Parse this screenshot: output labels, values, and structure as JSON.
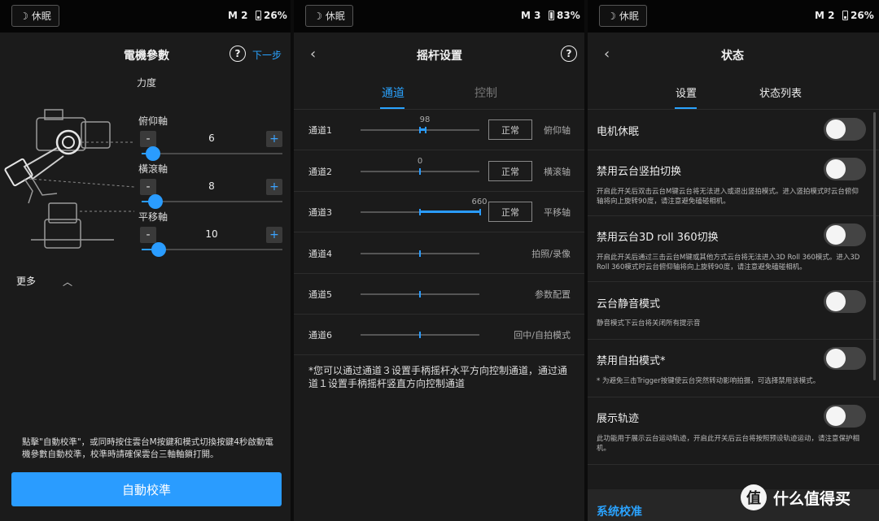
{
  "status_bars": [
    {
      "sleep": "休眠",
      "mode": "M 2",
      "battery": "26%"
    },
    {
      "sleep": "休眠",
      "mode": "M 3",
      "battery": "83%"
    },
    {
      "sleep": "休眠",
      "mode": "M 2",
      "battery": "26%"
    }
  ],
  "motor": {
    "title": "電機參數",
    "next": "下一步",
    "force_label": "力度",
    "axes": [
      {
        "name": "俯仰軸",
        "value": "6",
        "level": 0.05
      },
      {
        "name": "橫滾軸",
        "value": "8",
        "level": 0.07
      },
      {
        "name": "平移軸",
        "value": "10",
        "level": 0.09
      }
    ],
    "more": "更多",
    "note": "點擊\"自動校準\"，或同時按住雲台M按鍵和模式切換按鍵4秒啟動電機參數自動校準，校準時請確保雲台三軸軸鎖打開。",
    "calibrate": "自動校準"
  },
  "joystick": {
    "title": "摇杆设置",
    "tabs": [
      "通道",
      "控制"
    ],
    "channels": [
      {
        "label": "通道1",
        "value": "98",
        "button": "正常",
        "func": "俯仰轴",
        "fill": 0.08
      },
      {
        "label": "通道2",
        "value": "0",
        "button": "正常",
        "func": "横滚轴",
        "fill": 0
      },
      {
        "label": "通道3",
        "value": "660",
        "button": "正常",
        "func": "平移轴",
        "fill": 1.0
      },
      {
        "label": "通道4",
        "value": "",
        "button": "",
        "func": "拍照/录像",
        "fill": 0
      },
      {
        "label": "通道5",
        "value": "",
        "button": "",
        "func": "参数配置",
        "fill": 0
      },
      {
        "label": "通道6",
        "value": "",
        "button": "",
        "func": "回中/自拍模式",
        "fill": 0
      }
    ],
    "note": "*您可以通过通道３设置手柄摇杆水平方向控制通道，通过通道１设置手柄摇杆竖直方向控制通道"
  },
  "state": {
    "title": "状态",
    "tabs": [
      "设置",
      "状态列表"
    ],
    "settings": [
      {
        "title": "电机休眠",
        "desc": ""
      },
      {
        "title": "禁用云台竖拍切换",
        "desc": "开启此开关后双击云台M键云台将无法进入或退出竖拍模式。进入竖拍模式时云台俯仰轴将向上旋转90度，请注意避免磕碰相机。"
      },
      {
        "title": "禁用云台3D roll 360切换",
        "desc": "开启此开关后通过三击云台M键或其他方式云台将无法进入3D Roll 360模式。进入3D Roll 360模式时云台俯仰轴将向上旋转90度，请注意避免磕碰相机。"
      },
      {
        "title": "云台静音模式",
        "desc": "静音模式下云台将关闭所有提示音"
      },
      {
        "title": "禁用自拍模式*",
        "desc": "* 为避免三击Trigger按键使云台突然转动影响拍摄，可选择禁用该模式。"
      },
      {
        "title": "展示轨迹",
        "desc": "此功能用于展示云台运动轨迹，开启此开关后云台将按照预设轨迹运动，请注意保护相机。"
      }
    ],
    "section": "系统校准"
  },
  "watermark": {
    "badge": "值",
    "text": "什么值得买"
  }
}
